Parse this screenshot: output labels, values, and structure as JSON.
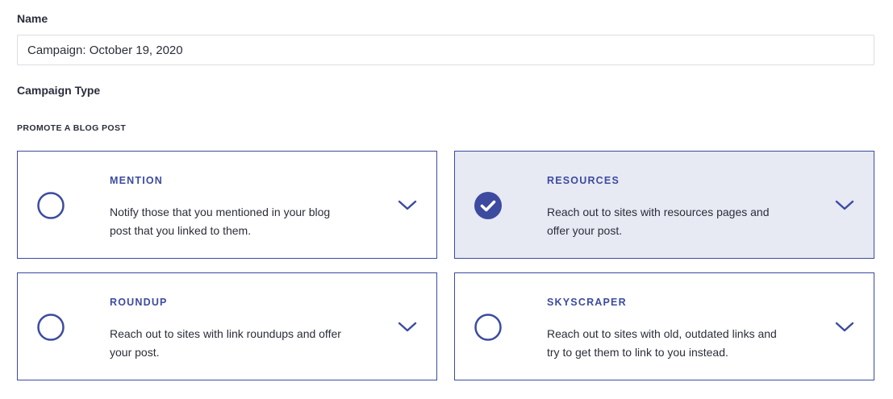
{
  "form": {
    "name_label": "Name",
    "name_value": "Campaign: October 19, 2020",
    "campaign_type_label": "Campaign Type",
    "section_label": "PROMOTE A BLOG POST"
  },
  "colors": {
    "accent": "#3c4ba0",
    "selected_background": "#e7e9f3",
    "text": "#2b2d3a"
  },
  "campaign_types": [
    {
      "title": "MENTION",
      "description": "Notify those that you mentioned in your blog post that you linked to them.",
      "selected": false,
      "icon": "radio-unchecked-icon"
    },
    {
      "title": "RESOURCES",
      "description": "Reach out to sites with resources pages and offer your post.",
      "selected": true,
      "icon": "check-circle-icon"
    },
    {
      "title": "ROUNDUP",
      "description": "Reach out to sites with link roundups and offer your post.",
      "selected": false,
      "icon": "radio-unchecked-icon"
    },
    {
      "title": "SKYSCRAPER",
      "description": "Reach out to sites with old, outdated links and try to get them to link to you instead.",
      "selected": false,
      "icon": "radio-unchecked-icon"
    }
  ]
}
